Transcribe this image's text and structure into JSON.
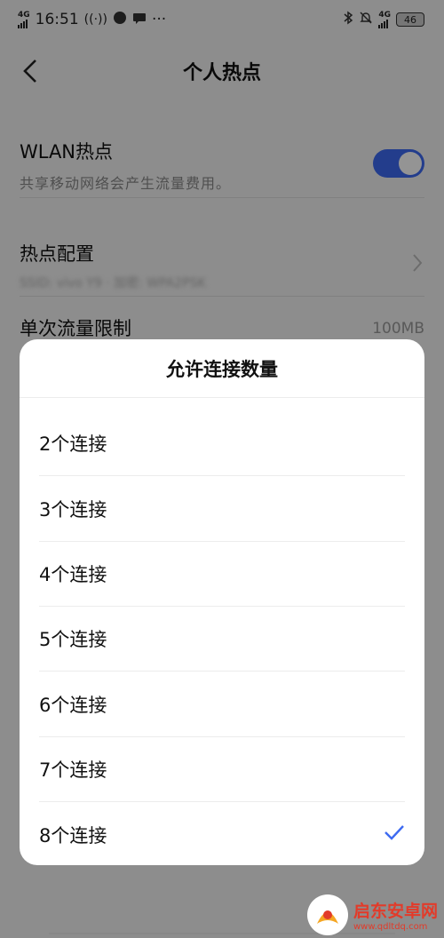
{
  "status_bar": {
    "network": "4G",
    "time": "16:51",
    "more": "···",
    "network_right": "4G",
    "battery": "46"
  },
  "nav": {
    "title": "个人热点"
  },
  "wlan": {
    "title": "WLAN热点",
    "subtitle": "共享移动网络会产生流量费用。",
    "enabled": true
  },
  "hotspot_config": {
    "title": "热点配置",
    "detail": "SSID: vivo Y9 · 加密: WPA2PSK"
  },
  "data_limit": {
    "title": "单次流量限制",
    "value": "100MB"
  },
  "dialog": {
    "title": "允许连接数量",
    "options": [
      "2个连接",
      "3个连接",
      "4个连接",
      "5个连接",
      "6个连接",
      "7个连接",
      "8个连接"
    ],
    "selected_index": 6
  },
  "watermark": {
    "name": "启东安卓网",
    "url": "www.qdltdq.com"
  },
  "colors": {
    "accent": "#3d6af1",
    "check": "#3d6af1"
  }
}
